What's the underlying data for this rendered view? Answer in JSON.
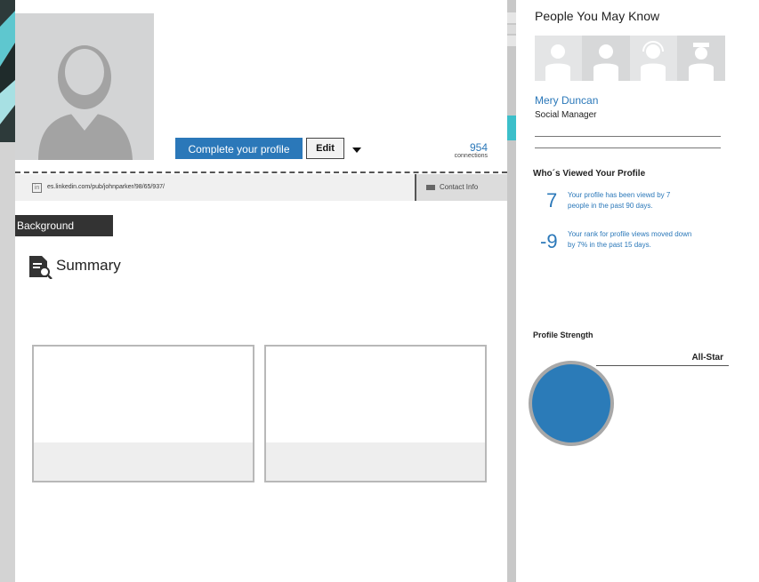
{
  "profile": {
    "complete_profile_label": "Complete your profile",
    "edit_label": "Edit",
    "connections_count": "954",
    "connections_label": "connections",
    "public_url": "es.linkedin.com/pub/johnparker/98/65/937/",
    "contact_info_label": "Contact Info",
    "linkedin_icon_glyph": "in"
  },
  "main": {
    "background_tab_label": "Background",
    "summary_title": "Summary"
  },
  "sidebar": {
    "pymk_title": "People You May Know",
    "person_name": "Mery Duncan",
    "person_role": "Social Manager",
    "who_viewed_title": "Who´s Viewed Your Profile",
    "stats": [
      {
        "number": "7",
        "text": "Your profile has been viewd by 7 people in the past 90 days."
      },
      {
        "number": "-9",
        "text": "Your rank for profile views moved down by 7% in the past 15 days."
      }
    ],
    "profile_strength_title": "Profile Strength",
    "profile_strength_level": "All-Star"
  },
  "icons": {
    "avatar": "user-silhouette-icon",
    "summary": "document-search-icon",
    "contact": "folder-icon",
    "dropdown": "caret-down-icon",
    "linkedin": "linkedin-icon"
  },
  "colors": {
    "accent": "#2b78b9",
    "teal": "#3cbfca",
    "dark_tab": "#333333",
    "card_border": "#b8b8b8"
  }
}
